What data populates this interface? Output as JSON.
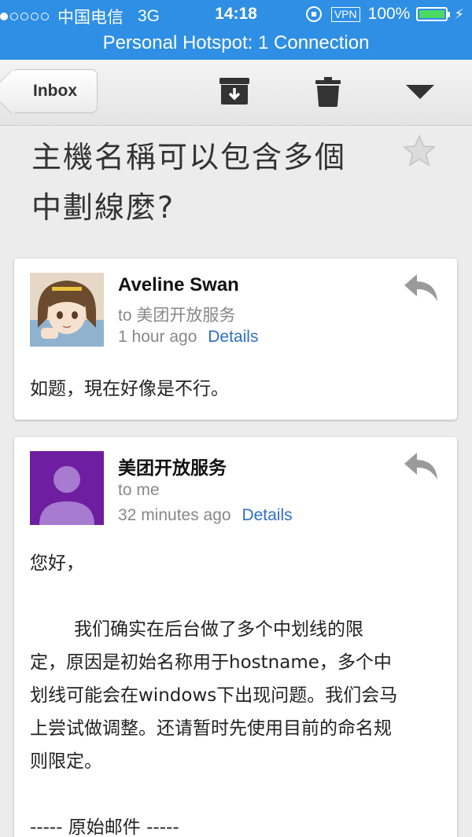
{
  "status_bar": {
    "carrier": "中国电信",
    "network": "3G",
    "time": "14:18",
    "vpn": "VPN",
    "battery": "100%",
    "battery_color": "#4cd964",
    "bar_color": "#2e8fe4"
  },
  "hotspot": {
    "text": "Personal Hotspot: 1 Connection"
  },
  "toolbar": {
    "back_label": "Inbox",
    "icons": [
      "archive-icon",
      "trash-icon",
      "dropdown-icon"
    ]
  },
  "subject": {
    "line1": "主機名稱可以包含多個",
    "line2": "中劃線麼?"
  },
  "messages": [
    {
      "sender": "Aveline Swan",
      "to": "to 美团开放服务",
      "time": "1 hour ago",
      "details": "Details",
      "body": "如题，現在好像是不行。"
    },
    {
      "sender": "美团开放服务",
      "to": "to me",
      "time": "32 minutes ago",
      "details": "Details",
      "greeting": "您好，",
      "body_line1": "我们确实在后台做了多个中划线的限",
      "body_line2": "定，原因是初始名称用于hostname，多个中",
      "body_line3": "划线可能会在windows下出现问题。我们会马",
      "body_line4": "上尝试做调整。还请暂时先使用目前的命名规",
      "body_line5": "则限定。",
      "original": "----- 原始邮件 -----"
    }
  ]
}
